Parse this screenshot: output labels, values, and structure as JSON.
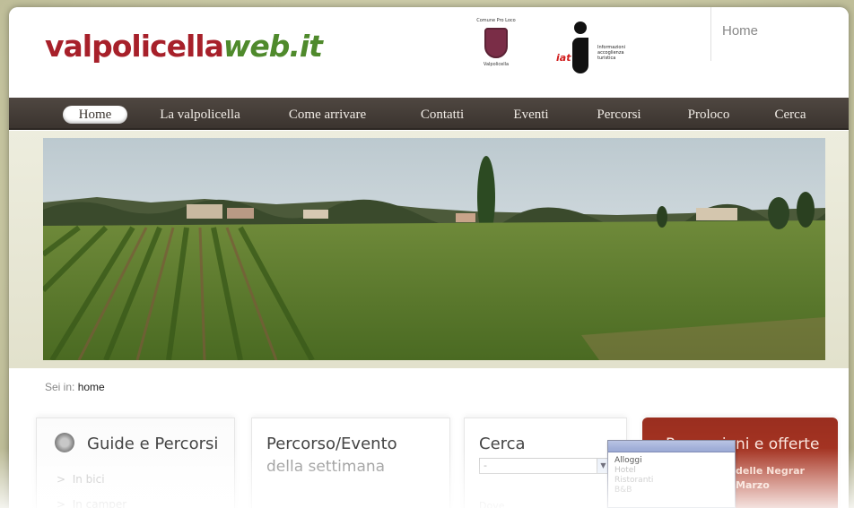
{
  "header": {
    "logo_part1": "valpolicella",
    "logo_part2": "web.it",
    "crest_caption_top": "Comune Pro Loco",
    "crest_caption_bottom": "Valpolicella",
    "info_letters": "iat",
    "info_text": "Informazioni accoglienza turistica",
    "home_link": "Home"
  },
  "nav": {
    "items": [
      {
        "label": "Home"
      },
      {
        "label": "La valpolicella"
      },
      {
        "label": "Come arrivare"
      },
      {
        "label": "Contatti"
      },
      {
        "label": "Eventi"
      },
      {
        "label": "Percorsi"
      },
      {
        "label": "Proloco"
      },
      {
        "label": "Cerca"
      }
    ]
  },
  "breadcrumb": {
    "prefix": "Sei in:",
    "current": "home"
  },
  "boxes": {
    "guide": {
      "title": "Guide e Percorsi",
      "links": [
        "In bici",
        "In camper"
      ]
    },
    "percorso": {
      "title": "Percorso/Evento",
      "subtitle": "della settimana"
    },
    "cerca": {
      "title": "Cerca",
      "select_value": "-",
      "below_label": "Dove"
    },
    "promo": {
      "title": "Promozioni e offerte",
      "line1": "delle Negrar",
      "line2": "Marzo"
    }
  },
  "dropdown": {
    "options": [
      "Alloggi",
      "Hotel",
      "Ristoranti",
      "B&B"
    ]
  }
}
